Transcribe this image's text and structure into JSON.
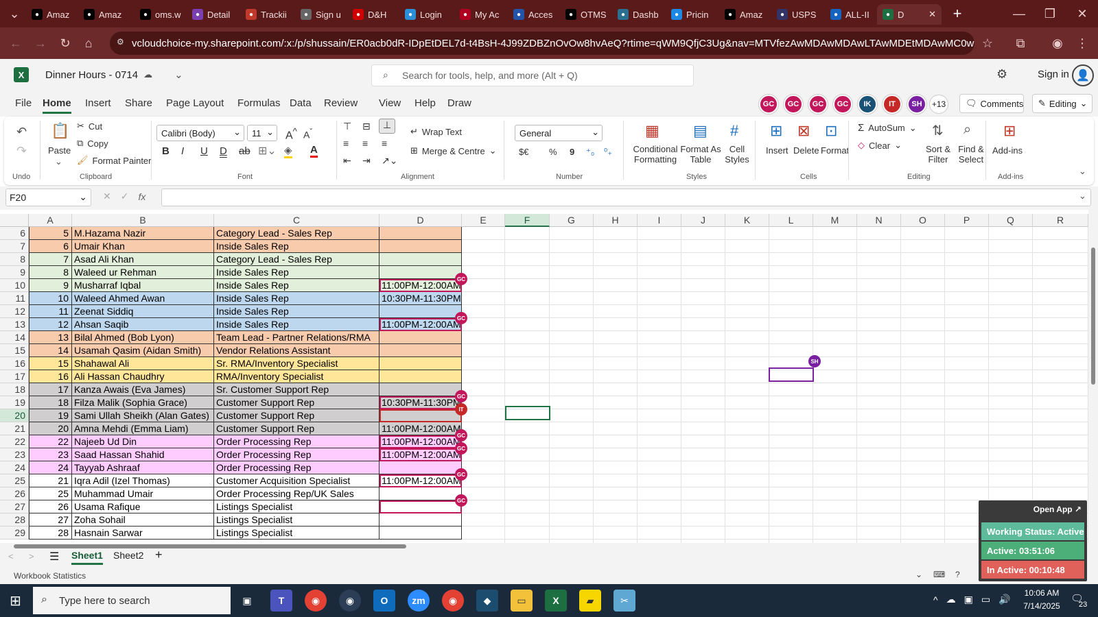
{
  "browser": {
    "tabs": [
      {
        "label": "Amaz",
        "icon": "amazon-icon",
        "color": "#000000"
      },
      {
        "label": "Amaz",
        "icon": "amazon-icon",
        "color": "#000000"
      },
      {
        "label": "oms.w",
        "icon": "oms-icon",
        "color": "#000000"
      },
      {
        "label": "Detail",
        "icon": "detail-icon",
        "color": "#7b3fb0"
      },
      {
        "label": "Trackii",
        "icon": "tracking-icon",
        "color": "#c0392b"
      },
      {
        "label": "Sign u",
        "icon": "globe-icon",
        "color": "#666666"
      },
      {
        "label": "D&H",
        "icon": "dh-icon",
        "color": "#d00000"
      },
      {
        "label": "Login",
        "icon": "login-icon",
        "color": "#2a8fd6"
      },
      {
        "label": "My Ac",
        "icon": "account-icon",
        "color": "#b00020"
      },
      {
        "label": "Acces",
        "icon": "im-icon",
        "color": "#2255aa"
      },
      {
        "label": "OTMS",
        "icon": "amazon-icon",
        "color": "#000000"
      },
      {
        "label": "Dashb",
        "icon": "dashboard-icon",
        "color": "#2a6f8f"
      },
      {
        "label": "Pricin",
        "icon": "pricing-icon",
        "color": "#1e88e5"
      },
      {
        "label": "Amaz",
        "icon": "amazon-icon",
        "color": "#000000"
      },
      {
        "label": "USPS",
        "icon": "usps-icon",
        "color": "#333366"
      },
      {
        "label": "ALL-II",
        "icon": "all-icon",
        "color": "#1565c0"
      },
      {
        "label": "D",
        "icon": "excel-icon",
        "color": "#1d6f42"
      }
    ],
    "url": "vcloudchoice-my.sharepoint.com/:x:/p/shussain/ER0acb0dR-IDpEtDEL7d-t4BsH-4J99ZDBZnOvOw8hvAeQ?rtime=qWM9QfjC3Ug&nav=MTVfezAwMDAwMDAwLTAwMDEtMDAwMC0wMDAwLTAwM..."
  },
  "excel": {
    "file_title": "Dinner Hours - 0714",
    "search_placeholder": "Search for tools, help, and more (Alt + Q)",
    "sign_in": "Sign in",
    "menus": [
      "File",
      "Home",
      "Insert",
      "Share",
      "Page Layout",
      "Formulas",
      "Data",
      "Review",
      "View",
      "Help",
      "Draw"
    ],
    "active_menu": "Home",
    "presence": [
      {
        "initials": "GC",
        "color": "#c2185b"
      },
      {
        "initials": "GC",
        "color": "#c2185b"
      },
      {
        "initials": "GC",
        "color": "#c2185b"
      },
      {
        "initials": "GC",
        "color": "#c2185b"
      },
      {
        "initials": "IK",
        "color": "#1a5276"
      },
      {
        "initials": "IT",
        "color": "#c62828"
      },
      {
        "initials": "SH",
        "color": "#7b1fa2"
      }
    ],
    "presence_more": "+13",
    "comments_label": "Comments",
    "editing_label": "Editing",
    "ribbon": {
      "undo_group": "Undo",
      "paste": "Paste",
      "cut": "Cut",
      "copy": "Copy",
      "format_painter": "Format Painter",
      "clipboard_group": "Clipboard",
      "font_name": "Calibri (Body)",
      "font_size": "11",
      "font_group": "Font",
      "wrap_text": "Wrap Text",
      "merge_centre": "Merge & Centre",
      "alignment_group": "Alignment",
      "number_format": "General",
      "currency": "$€",
      "percent": "%",
      "comma": "9",
      "number_group": "Number",
      "conditional_formatting": [
        "Conditional",
        "Formatting"
      ],
      "format_as_table": [
        "Format As",
        "Table"
      ],
      "cell_styles": [
        "Cell",
        "Styles"
      ],
      "styles_group": "Styles",
      "insert": "Insert",
      "delete": "Delete",
      "format": "Format",
      "cells_group": "Cells",
      "autosum": "AutoSum",
      "clear": "Clear",
      "sort_filter": [
        "Sort &",
        "Filter"
      ],
      "find_select": [
        "Find &",
        "Select"
      ],
      "editing_group": "Editing",
      "addins": "Add-ins",
      "addins_group": "Add-ins"
    },
    "name_box": "F20",
    "columns": [
      "A",
      "B",
      "C",
      "D",
      "E",
      "F",
      "G",
      "H",
      "I",
      "J",
      "K",
      "L",
      "M",
      "N",
      "O",
      "P",
      "Q",
      "R"
    ],
    "selected_column": "F",
    "selected_row": "20",
    "rows": [
      {
        "row": "6",
        "a": "5",
        "b": "M.Hazama Nazir",
        "c": "Category Lead - Sales Rep",
        "d": "",
        "color": "#f8cbad"
      },
      {
        "row": "7",
        "a": "6",
        "b": "Umair Khan",
        "c": "Inside Sales Rep",
        "d": "",
        "color": "#f8cbad"
      },
      {
        "row": "8",
        "a": "7",
        "b": "Asad Ali Khan",
        "c": "Category Lead - Sales Rep",
        "d": "",
        "color": "#e2efda"
      },
      {
        "row": "9",
        "a": "8",
        "b": "Waleed ur Rehman",
        "c": "Inside Sales Rep",
        "d": "",
        "color": "#e2efda"
      },
      {
        "row": "10",
        "a": "9",
        "b": "Musharraf Iqbal",
        "c": "Inside Sales Rep",
        "d": "11:00PM-12:00AM",
        "color": "#e2efda"
      },
      {
        "row": "11",
        "a": "10",
        "b": "Waleed Ahmed Awan",
        "c": "Inside Sales Rep",
        "d": "10:30PM-11:30PM",
        "color": "#bdd7ee"
      },
      {
        "row": "12",
        "a": "11",
        "b": "Zeenat Siddiq",
        "c": "Inside Sales Rep",
        "d": "",
        "color": "#bdd7ee"
      },
      {
        "row": "13",
        "a": "12",
        "b": "Ahsan Saqib",
        "c": "Inside Sales Rep",
        "d": "11:00PM-12:00AM",
        "color": "#bdd7ee"
      },
      {
        "row": "14",
        "a": "13",
        "b": "Bilal Ahmed (Bob Lyon)",
        "c": "Team Lead - Partner Relations/RMA",
        "d": "",
        "color": "#f8cbad"
      },
      {
        "row": "15",
        "a": "14",
        "b": "Usamah Qasim (Aidan Smith)",
        "c": "Vendor Relations Assistant",
        "d": "",
        "color": "#f8cbad"
      },
      {
        "row": "16",
        "a": "15",
        "b": "Shahawal Ali",
        "c": "Sr. RMA/Inventory Specialist",
        "d": "",
        "color": "#ffe699"
      },
      {
        "row": "17",
        "a": "16",
        "b": "Ali Hassan Chaudhry",
        "c": "RMA/Inventory Specialist",
        "d": "",
        "color": "#ffe699"
      },
      {
        "row": "18",
        "a": "17",
        "b": "Kanza Awais (Eva James)",
        "c": "Sr. Customer Support Rep",
        "d": "",
        "color": "#d0cece"
      },
      {
        "row": "19",
        "a": "18",
        "b": "Filza Malik (Sophia Grace)",
        "c": "Customer Support Rep",
        "d": "10:30PM-11:30PM",
        "color": "#d0cece"
      },
      {
        "row": "20",
        "a": "19",
        "b": "Sami Ullah Sheikh (Alan Gates)",
        "c": "Customer Support Rep",
        "d": "",
        "color": "#d0cece"
      },
      {
        "row": "21",
        "a": "20",
        "b": "Amna Mehdi (Emma Liam)",
        "c": "Customer Support Rep",
        "d": "11:00PM-12:00AM",
        "color": "#d0cece"
      },
      {
        "row": "22",
        "a": "22",
        "b": "Najeeb Ud Din",
        "c": "Order Processing Rep",
        "d": "11:00PM-12:00AM",
        "color": "#ffccff"
      },
      {
        "row": "23",
        "a": "23",
        "b": "Saad Hassan Shahid",
        "c": "Order Processing Rep",
        "d": "11:00PM-12:00AM",
        "color": "#ffccff"
      },
      {
        "row": "24",
        "a": "24",
        "b": "Tayyab Ashraaf",
        "c": "Order Processing Rep",
        "d": "",
        "color": "#ffccff"
      },
      {
        "row": "25",
        "a": "21",
        "b": "Iqra Adil (Izel Thomas)",
        "c": "Customer Acquisition Specialist",
        "d": "11:00PM-12:00AM",
        "color": "#ffffff"
      },
      {
        "row": "26",
        "a": "25",
        "b": "Muhammad Umair",
        "c": "Order Processing Rep/UK Sales",
        "d": "",
        "color": "#ffffff"
      },
      {
        "row": "27",
        "a": "26",
        "b": "Usama Rafique",
        "c": "Listings Specialist",
        "d": "",
        "color": "#ffffff"
      },
      {
        "row": "28",
        "a": "27",
        "b": "Zoha Sohail",
        "c": "Listings Specialist",
        "d": "",
        "color": "#ffffff"
      },
      {
        "row": "29",
        "a": "28",
        "b": "Hasnain Sarwar",
        "c": "Listings Specialist",
        "d": "",
        "color": "#ffffff"
      }
    ],
    "cell_presence": [
      {
        "initials": "GC",
        "color": "#c2185b"
      },
      {
        "initials": "GC",
        "color": "#c2185b"
      },
      {
        "initials": "GC",
        "color": "#c2185b"
      },
      {
        "initials": "IT",
        "color": "#c62828"
      },
      {
        "initials": "GC",
        "color": "#c2185b"
      },
      {
        "initials": "GC",
        "color": "#c2185b"
      },
      {
        "initials": "GC",
        "color": "#c2185b"
      },
      {
        "initials": "GC",
        "color": "#c2185b"
      },
      {
        "initials": "SH",
        "color": "#7b1fa2"
      }
    ],
    "sheets": [
      "Sheet1",
      "Sheet2"
    ],
    "active_sheet": "Sheet1",
    "status_left": "Workbook Statistics"
  },
  "tracker": {
    "open_app": "Open App ↗",
    "working_status": "Working Status: Active",
    "active": "Active: 03:51:06",
    "inactive": "In Active: 00:10:48",
    "colors": {
      "status": "#5dbb9b",
      "active": "#4caf7a",
      "inactive": "#e0605a"
    }
  },
  "taskbar": {
    "search_placeholder": "Type here to search",
    "time": "10:06 AM",
    "date": "7/14/2025",
    "notifications": "23"
  }
}
